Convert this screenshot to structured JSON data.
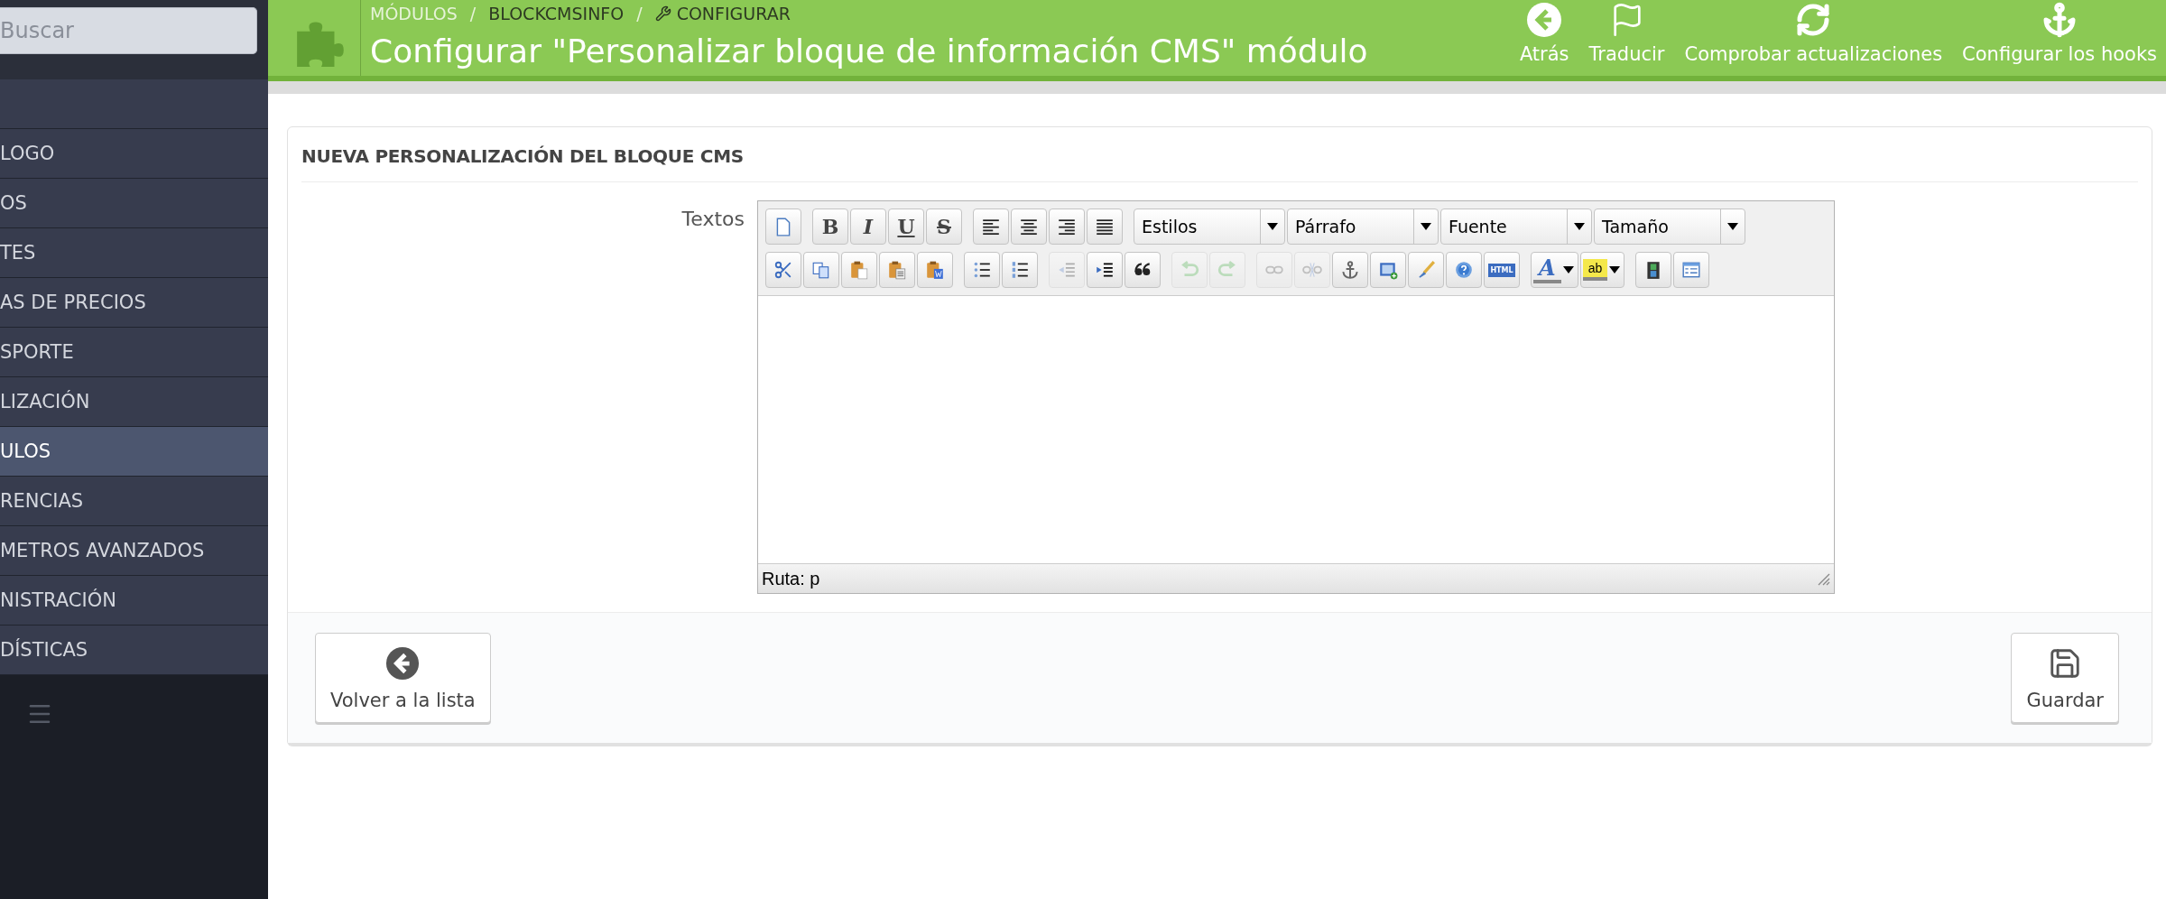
{
  "sidebar": {
    "search": {
      "placeholder": "Buscar"
    },
    "items": [
      {
        "label": "LOGO",
        "selected": false
      },
      {
        "label": "OS",
        "selected": false
      },
      {
        "label": "TES",
        "selected": false
      },
      {
        "label": "AS DE PRECIOS",
        "selected": false
      },
      {
        "label": "SPORTE",
        "selected": false
      },
      {
        "label": "LIZACIÓN",
        "selected": false
      },
      {
        "label": "ULOS",
        "selected": true
      },
      {
        "label": "RENCIAS",
        "selected": false
      },
      {
        "label": "METROS AVANZADOS",
        "selected": false
      },
      {
        "label": "NISTRACIÓN",
        "selected": false
      },
      {
        "label": "DÍSTICAS",
        "selected": false
      }
    ]
  },
  "header": {
    "breadcrumb": [
      "MÓDULOS",
      "BLOCKCMSINFO",
      "CONFIGURAR"
    ],
    "separator": "/",
    "title": "Configurar \"Personalizar bloque de información CMS\" módulo",
    "actions": [
      {
        "kind": "back",
        "label": "Atrás"
      },
      {
        "kind": "flag",
        "label": "Traducir"
      },
      {
        "kind": "refresh",
        "label": "Comprobar actualizaciones"
      },
      {
        "kind": "anchor",
        "label": "Configurar los hooks"
      }
    ]
  },
  "panel": {
    "heading": "NUEVA PERSONALIZACIÓN DEL BLOQUE CMS",
    "field_label": "Textos",
    "editor": {
      "toolbar": [
        [
          [
            {
              "kind": "newdoc",
              "disabled": false
            }
          ],
          [
            {
              "kind": "bold",
              "label": "B",
              "disabled": false
            },
            {
              "kind": "italic",
              "label": "I",
              "disabled": false
            },
            {
              "kind": "underline",
              "label": "U",
              "disabled": false
            },
            {
              "kind": "strike",
              "label": "S",
              "disabled": false
            }
          ],
          [
            {
              "kind": "alignleft",
              "disabled": false
            },
            {
              "kind": "aligncenter",
              "disabled": false
            },
            {
              "kind": "alignright",
              "disabled": false
            },
            {
              "kind": "justify",
              "disabled": false
            }
          ],
          [
            {
              "kind": "select",
              "label": "Estilos"
            },
            {
              "kind": "select",
              "label": "Párrafo"
            },
            {
              "kind": "select",
              "label": "Fuente"
            },
            {
              "kind": "select",
              "label": "Tamaño"
            }
          ]
        ],
        [
          [
            {
              "kind": "cut",
              "disabled": false
            },
            {
              "kind": "copy",
              "disabled": false
            },
            {
              "kind": "paste",
              "disabled": false
            },
            {
              "kind": "pastetext",
              "disabled": false
            },
            {
              "kind": "pasteword",
              "disabled": false
            }
          ],
          [
            {
              "kind": "bullets",
              "disabled": false
            },
            {
              "kind": "numbers",
              "disabled": false
            }
          ],
          [
            {
              "kind": "outdent",
              "disabled": true
            },
            {
              "kind": "indent",
              "disabled": false
            },
            {
              "kind": "quote",
              "disabled": false
            }
          ],
          [
            {
              "kind": "undo",
              "disabled": true
            },
            {
              "kind": "redo",
              "disabled": true
            }
          ],
          [
            {
              "kind": "link",
              "disabled": true
            },
            {
              "kind": "unlink",
              "disabled": true
            },
            {
              "kind": "anchor",
              "disabled": false
            },
            {
              "kind": "image",
              "disabled": false
            },
            {
              "kind": "brush",
              "disabled": false
            },
            {
              "kind": "help",
              "disabled": false
            },
            {
              "kind": "html",
              "label": "HTML",
              "disabled": false
            }
          ],
          [
            {
              "kind": "fontcolor",
              "label": "A",
              "disabled": false
            },
            {
              "kind": "highlight",
              "label": "ab",
              "disabled": false
            }
          ],
          [
            {
              "kind": "media",
              "disabled": false
            },
            {
              "kind": "template",
              "disabled": false
            }
          ]
        ]
      ],
      "path": "Ruta: p"
    }
  },
  "footer": {
    "buttons": [
      {
        "kind": "back",
        "label": "Volver a la lista"
      },
      {
        "kind": "save",
        "label": "Guardar"
      }
    ]
  }
}
